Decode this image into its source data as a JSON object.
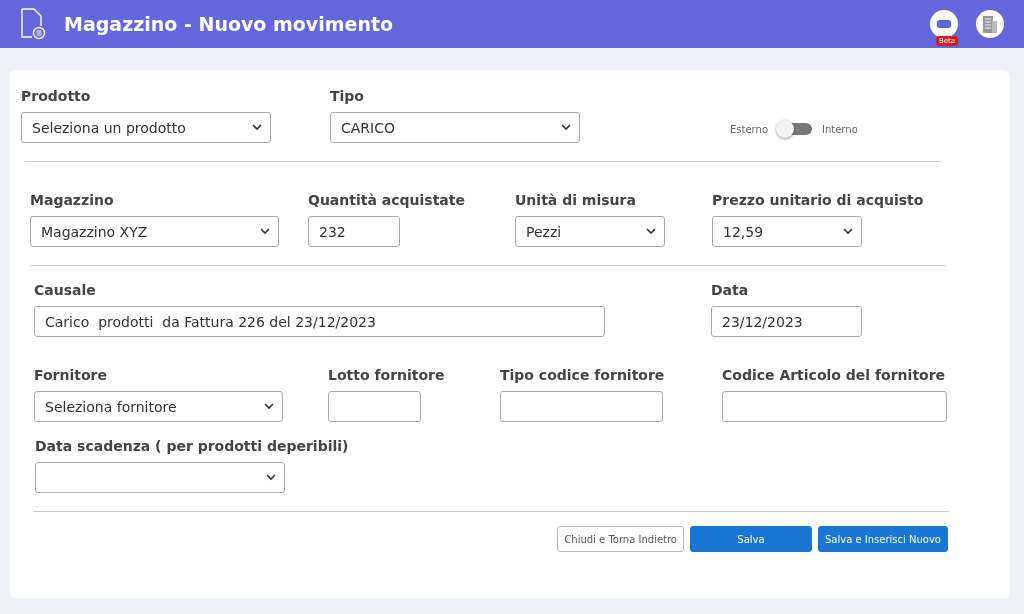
{
  "header": {
    "title": "Magazzino - Nuovo movimento",
    "beta_badge": "Beta"
  },
  "rows": [
    {
      "fields": [
        {
          "label": "Prodotto",
          "kind": "select",
          "value": "Seleziona un prodotto"
        },
        {
          "label": "Tipo",
          "kind": "select",
          "value": "CARICO"
        }
      ],
      "toggle": {
        "left_label": "Esterno",
        "right_label": "Interno",
        "on": false
      }
    },
    {
      "fields": [
        {
          "label": "Magazzino",
          "kind": "select",
          "value": "Magazzino XYZ"
        },
        {
          "label": "Quantità acquistate",
          "kind": "input",
          "value": "232"
        },
        {
          "label": "Unità di misura",
          "kind": "select",
          "value": "Pezzi"
        },
        {
          "label": "Prezzo unitario di acquisto",
          "kind": "select",
          "value": "12,59"
        }
      ]
    },
    {
      "fields": [
        {
          "label": "Causale",
          "kind": "input",
          "value": "Carico  prodotti  da Fattura 226 del 23/12/2023"
        },
        {
          "label": "Data",
          "kind": "input",
          "value": "23/12/2023"
        }
      ]
    },
    {
      "fields": [
        {
          "label": "Fornitore",
          "kind": "select",
          "value": "Seleziona fornitore"
        },
        {
          "label": "Lotto fornitore",
          "kind": "input"
        },
        {
          "label": "Tipo codice fornitore",
          "kind": "input"
        },
        {
          "label": "Codice Articolo del fornitore",
          "kind": "input"
        }
      ]
    },
    {
      "fields": [
        {
          "label": "Data scadenza ( per prodotti deperibili)",
          "kind": "select"
        }
      ]
    }
  ],
  "buttons": [
    {
      "label": "Chiudi e Torna Indietro",
      "kind": "secondary"
    },
    {
      "label": "Salva",
      "kind": "primary"
    },
    {
      "label": "Salva e Inserisci Nuovo",
      "kind": "primary"
    }
  ]
}
